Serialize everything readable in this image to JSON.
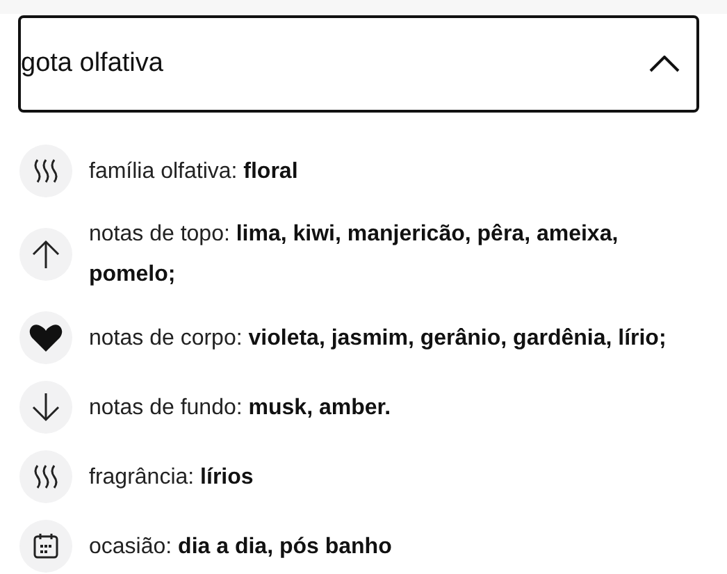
{
  "header": {
    "title": "gota olfativa",
    "expanded": true
  },
  "items": [
    {
      "kind": "steam",
      "text": "família olfativa: **floral**"
    },
    {
      "kind": "arrow-up",
      "text": "notas de topo: **lima, kiwi, manjericão, pêra, ameixa, pomelo;**"
    },
    {
      "kind": "heart",
      "text": "notas de corpo: **violeta, jasmim, gerânio, gardênia, lírio;**"
    },
    {
      "kind": "arrow-down",
      "text": "notas de fundo: **musk, amber.**"
    },
    {
      "kind": "steam",
      "text": "fragrância: **lírios**"
    },
    {
      "kind": "calendar",
      "text": "ocasião: **dia a dia, pós banho**"
    }
  ]
}
